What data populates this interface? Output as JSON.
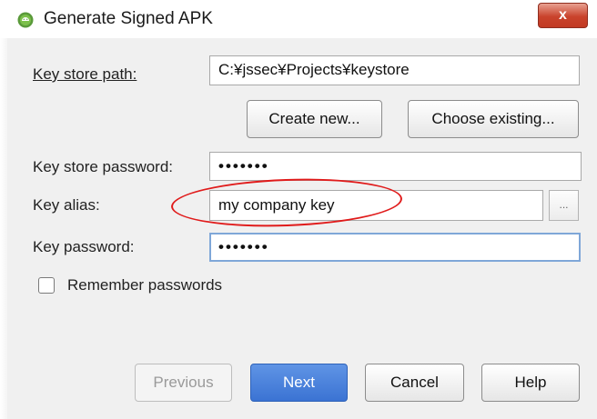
{
  "window": {
    "title": "Generate Signed APK",
    "close_glyph": "x"
  },
  "form": {
    "key_store_path": {
      "label": "Key store path:",
      "value": "C:¥jssec¥Projects¥keystore"
    },
    "create_new_label": "Create new...",
    "choose_existing_label": "Choose existing...",
    "key_store_password": {
      "label": "Key store password:",
      "value": "•••••••"
    },
    "key_alias": {
      "label": "Key alias:",
      "value": "my company key",
      "browse_label": "..."
    },
    "key_password": {
      "label": "Key password:",
      "value": "•••••••"
    },
    "remember_passwords": {
      "label": "Remember passwords",
      "checked": false
    }
  },
  "footer": {
    "previous_label": "Previous",
    "next_label": "Next",
    "cancel_label": "Cancel",
    "help_label": "Help"
  },
  "annotation": {
    "color": "#e01b1b",
    "shape": "ellipse around key alias"
  },
  "colors": {
    "primary_button": "#3b73d3",
    "close_button": "#c9432c",
    "focus_border": "#7fa7d8"
  },
  "icons": {
    "app": "android-icon",
    "close": "close-icon"
  }
}
